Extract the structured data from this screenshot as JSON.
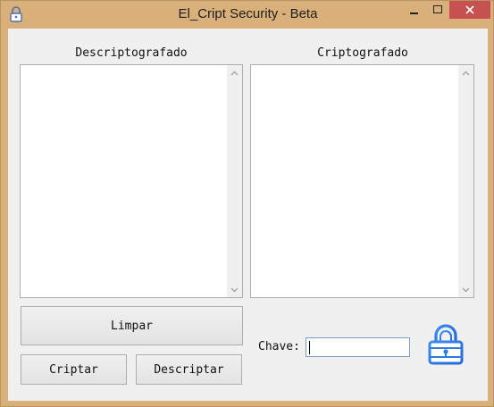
{
  "window": {
    "title": "El_Cript Security - Beta",
    "controls": {
      "minimize_glyph": "‒",
      "maximize_glyph": "□",
      "close_glyph": "✕"
    }
  },
  "panels": {
    "left_label": "Descriptografado",
    "right_label": "Criptografado",
    "left_text": "",
    "right_text": ""
  },
  "buttons": {
    "clear": "Limpar",
    "encrypt": "Criptar",
    "decrypt": "Descriptar"
  },
  "key": {
    "label": "Chave:",
    "value": ""
  },
  "icons": {
    "app": "lock-icon",
    "logo": "padlock-logo-icon"
  },
  "colors": {
    "frame": "#d9b07a",
    "close_button": "#c75050",
    "logo_blue": "#2b7be4"
  }
}
